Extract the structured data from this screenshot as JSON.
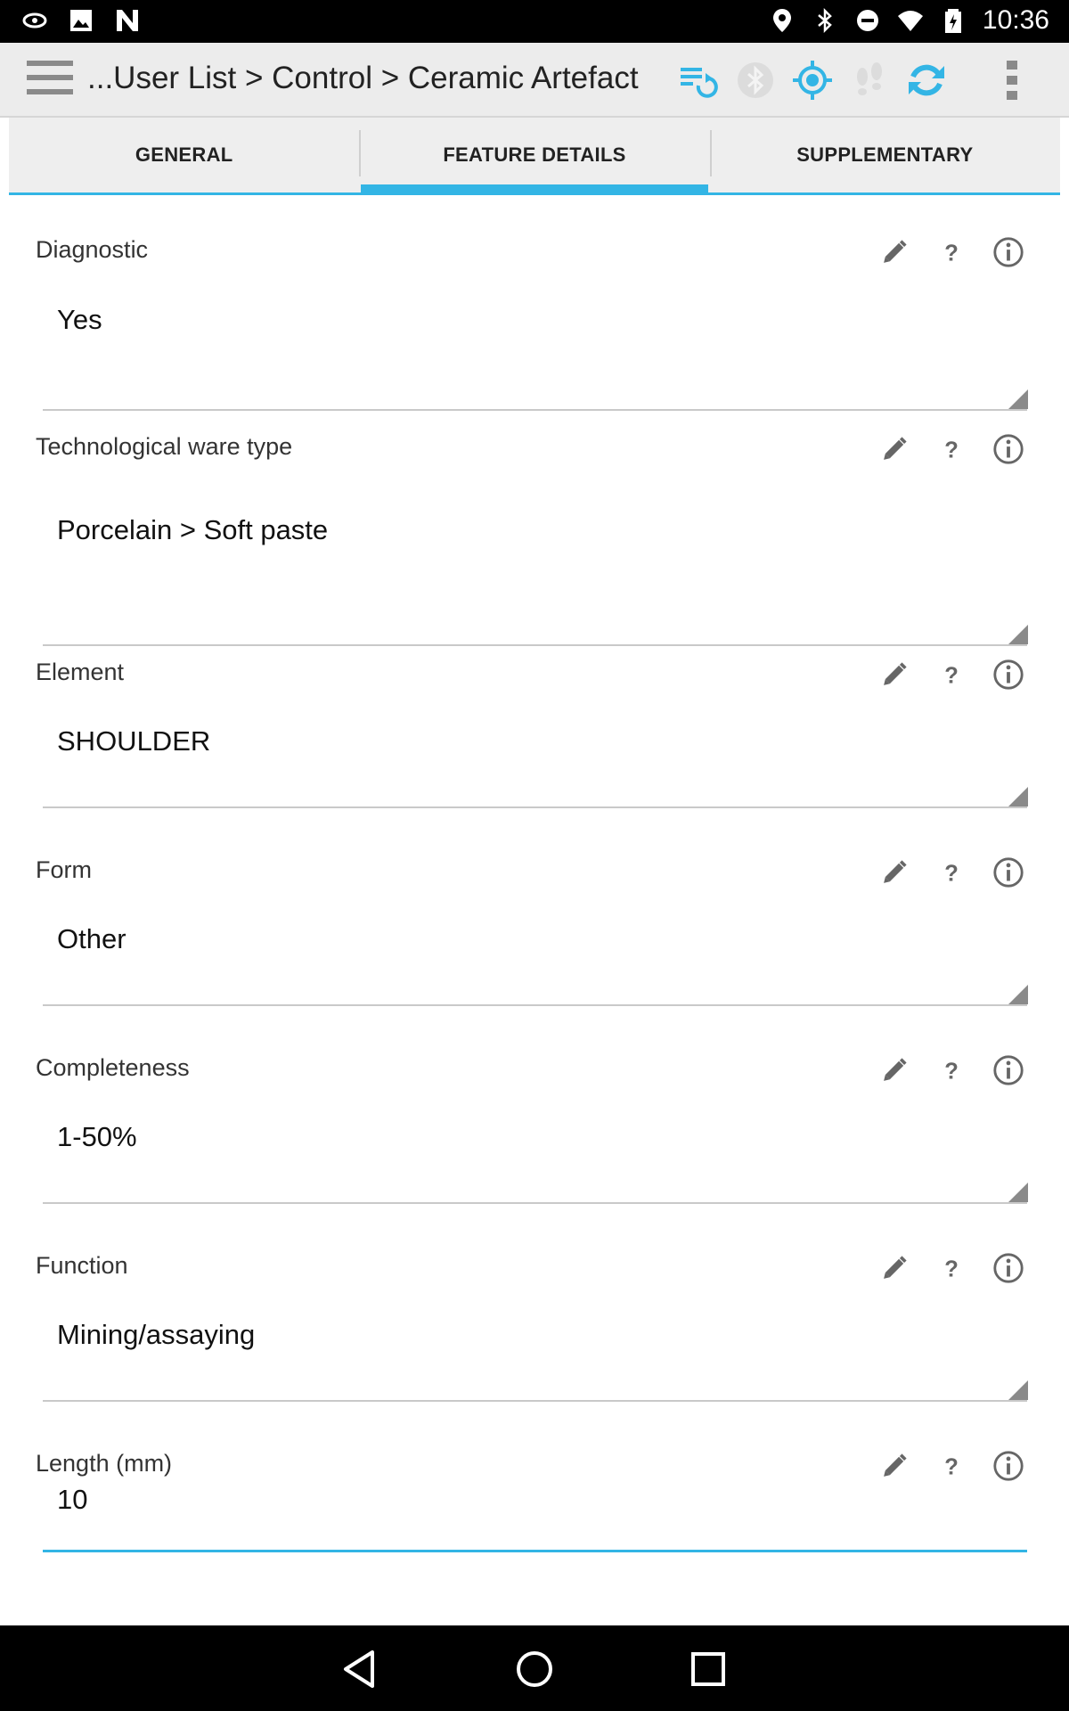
{
  "status_bar": {
    "time": "10:36",
    "left_icons": [
      "eye-notification-icon",
      "image-notification-icon",
      "n-logo-notification-icon"
    ],
    "right_icons": [
      "location-icon",
      "bluetooth-icon",
      "do-not-disturb-icon",
      "wifi-icon",
      "battery-icon"
    ]
  },
  "action_bar": {
    "breadcrumb": "...User List > Control > Ceramic Artefact",
    "icons": [
      "menu-icon",
      "sync-list-icon",
      "bluetooth-disabled-icon",
      "gps-icon",
      "footprints-icon",
      "refresh-icon",
      "overflow-menu-icon"
    ],
    "accent_color": "#33b5e5"
  },
  "tabs": [
    {
      "label": "GENERAL",
      "active": false
    },
    {
      "label": "FEATURE DETAILS",
      "active": true
    },
    {
      "label": "SUPPLEMENTARY",
      "active": false
    }
  ],
  "fields": [
    {
      "label": "Diagnostic",
      "value": "Yes"
    },
    {
      "label": "Technological ware type",
      "value": "Porcelain > Soft paste"
    },
    {
      "label": "Element",
      "value": "SHOULDER"
    },
    {
      "label": "Form",
      "value": "Other"
    },
    {
      "label": "Completeness",
      "value": "1-50%"
    },
    {
      "label": "Function",
      "value": "Mining/assaying"
    },
    {
      "label": "Length (mm)",
      "value": "10"
    }
  ],
  "field_icons": [
    "pencil-icon",
    "help-icon",
    "info-icon"
  ],
  "nav_bar": [
    "back-icon",
    "home-icon",
    "recents-icon"
  ]
}
